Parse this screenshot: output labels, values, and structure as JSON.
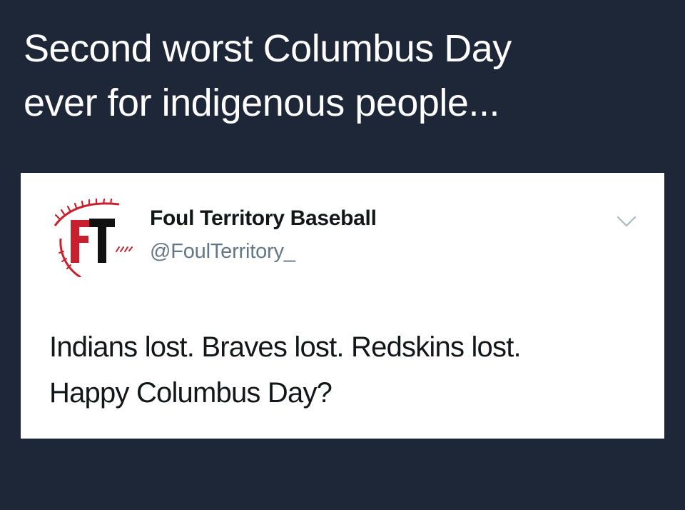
{
  "caption": {
    "line1": "Second worst Columbus Day",
    "line2": "ever for indigenous people..."
  },
  "tweet": {
    "author_name": "Foul Territory Baseball",
    "author_handle": "@FoulTerritory_",
    "text_line1": "Indians lost. Braves lost. Redskins lost.",
    "text_line2": "Happy Columbus Day?",
    "logo_text": "FT",
    "menu_icon": "chevron-down-icon"
  },
  "colors": {
    "background": "#1d2738",
    "card": "#ffffff",
    "logo_red": "#c8202f",
    "logo_black": "#111111",
    "handle_gray": "#657786",
    "chevron_gray": "#aab8c2"
  }
}
